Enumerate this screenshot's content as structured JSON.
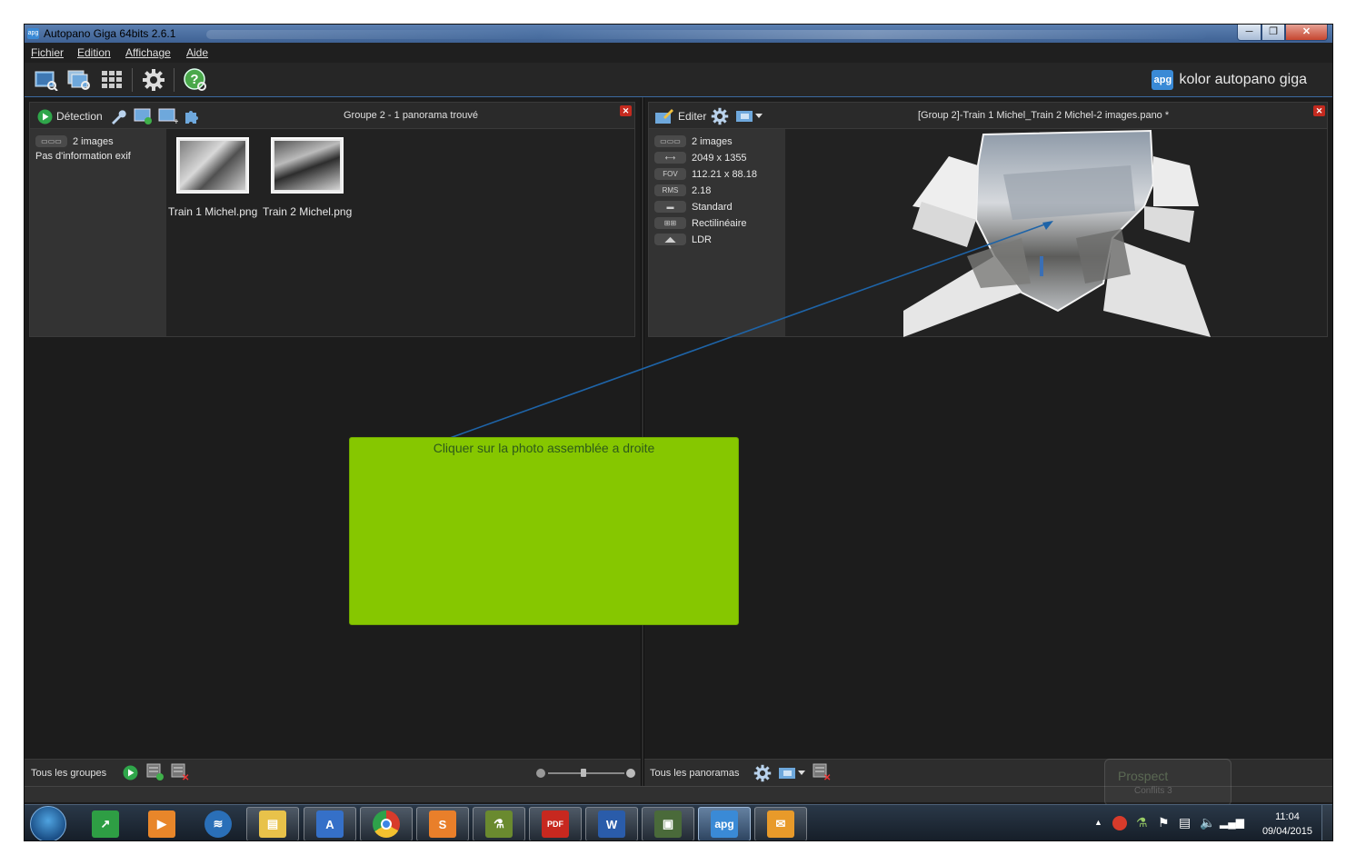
{
  "window": {
    "title": "Autopano Giga 64bits 2.6.1",
    "app_icon": "apg"
  },
  "menu": [
    "Fichier",
    "Edition",
    "Affichage",
    "Aide"
  ],
  "brand": {
    "logo": "apg",
    "name": "kolor autopano giga"
  },
  "left_panel": {
    "detect_label": "Détection",
    "title": "Groupe 2 - 1 panorama trouvé",
    "info": {
      "images": "2 images",
      "exif": "Pas d'information exif"
    },
    "thumbnails": [
      "Train 1 Michel.png",
      "Train 2 Michel.png"
    ]
  },
  "right_panel": {
    "edit_label": "Editer",
    "title": "[Group 2]-Train 1 Michel_Train 2 Michel-2 images.pano *",
    "info": {
      "images": "2 images",
      "size": "2049 x 1355",
      "fov_badge": "FOV",
      "fov": "112.21 x 88.18",
      "rms_badge": "RMS",
      "rms": "2.18",
      "quality": "Standard",
      "projection": "Rectilinéaire",
      "range": "LDR"
    }
  },
  "bottom_left": {
    "label": "Tous les groupes"
  },
  "bottom_right": {
    "label": "Tous les panoramas"
  },
  "callout": {
    "text": "Cliquer sur la photo assemblée a droite",
    "color": "#86c700"
  },
  "ghost_popup": {
    "title": "Prospect",
    "sub": "Conflits 3"
  },
  "taskbar": {
    "items": [
      "trend-icon",
      "media-icon",
      "wifi-icon",
      "explorer-icon",
      "autodesk-icon",
      "chrome-icon",
      "sublime-icon",
      "flask-icon",
      "pdf-icon",
      "word-icon",
      "remote-desktop-icon",
      "apg-icon",
      "outlook-icon"
    ],
    "active": "apg-icon",
    "apg_label": "apg",
    "word_label": "W",
    "sublime_label": "S",
    "pdf_label": "PDF"
  },
  "clock": {
    "time": "11:04",
    "date": "09/04/2015"
  }
}
